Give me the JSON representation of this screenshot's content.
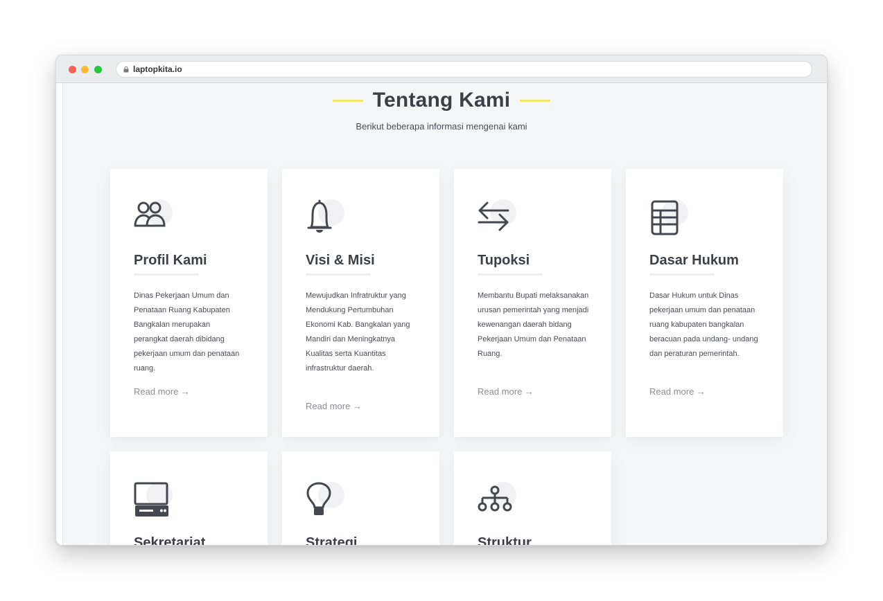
{
  "browser": {
    "url": "laptopkita.io"
  },
  "section": {
    "title": "Tentang Kami",
    "subtitle": "Berikut beberapa informasi mengenai kami"
  },
  "cards": [
    {
      "icon": "people-icon",
      "title": "Profil Kami",
      "description": "Dinas Pekerjaan Umum dan Penataan Ruang Kabupaten Bangkalan merupakan perangkat daerah dibidang pekerjaan umum dan penataan ruang.",
      "read_more": "Read more →"
    },
    {
      "icon": "bell-icon",
      "title": "Visi & Misi",
      "description": "Mewujudkan Infratruktur yang Mendukung Pertumbuhan Ekonomi Kab. Bangkalan yang Mandiri dan Meningkatnya Kualitas serta Kuantitas infrastruktur daerah.",
      "read_more": "Read more →"
    },
    {
      "icon": "arrows-exchange-icon",
      "title": "Tupoksi",
      "description": "Membantu Bupati melaksanakan urusan pemerintah yang menjadi kewenangan daerah bidang Pekerjaan Umum dan Penataan Ruang.",
      "read_more": "Read more →"
    },
    {
      "icon": "ledger-icon",
      "title": "Dasar Hukum",
      "description": "Dasar Hukum untuk Dinas pekerjaan umum dan penataan ruang kabupaten bangkalan beracuan pada undang- undang dan peraturan pemerintah.",
      "read_more": "Read more →"
    },
    {
      "icon": "computer-icon",
      "title": "Sekretariat"
    },
    {
      "icon": "lightbulb-icon",
      "title": "Strategi"
    },
    {
      "icon": "org-structure-icon",
      "title": "Struktur"
    }
  ]
}
